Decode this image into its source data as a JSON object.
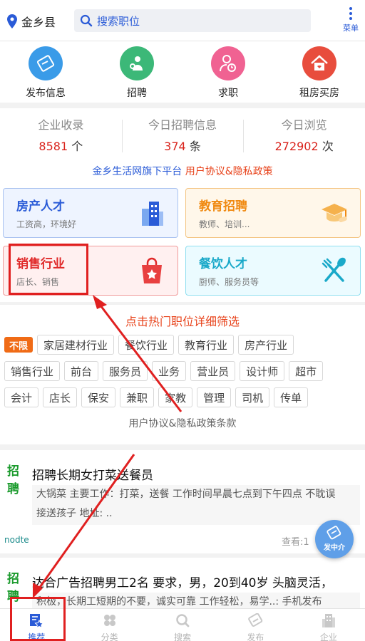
{
  "topbar": {
    "location": "金乡县",
    "search_placeholder": "搜索职位",
    "menu_label": "菜单"
  },
  "quick": [
    {
      "label": "发布信息",
      "icon": "edit-icon",
      "color": "#3a9be8"
    },
    {
      "label": "招聘",
      "icon": "recruit-icon",
      "color": "#3cb878"
    },
    {
      "label": "求职",
      "icon": "job-seek-icon",
      "color": "#f06292"
    },
    {
      "label": "租房买房",
      "icon": "house-icon",
      "color": "#e84d3d"
    }
  ],
  "stats": [
    {
      "title": "企业收录",
      "value": "8581",
      "unit": "个"
    },
    {
      "title": "今日招聘信息",
      "value": "374",
      "unit": "条"
    },
    {
      "title": "今日浏览",
      "value": "272902",
      "unit": "次"
    }
  ],
  "platform": {
    "text": "金乡生活网旗下平台",
    "link": "用户协议&隐私政策"
  },
  "cards": [
    {
      "title": "房产人才",
      "sub": "工资高，环境好",
      "icon": "building-icon"
    },
    {
      "title": "教育招聘",
      "sub": "教师、培训...",
      "icon": "graduation-cap-icon"
    },
    {
      "title": "销售行业",
      "sub": "店长、销售",
      "icon": "shopping-bag-icon"
    },
    {
      "title": "餐饮人才",
      "sub": "厨师、服务员等",
      "icon": "fork-spoon-icon"
    }
  ],
  "tags": {
    "heading": "点击热门职位详细筛选",
    "hot": "不限",
    "row1": [
      "家居建材行业",
      "餐饮行业",
      "教育行业",
      "房产行业"
    ],
    "row2": [
      "销售行业",
      "前台",
      "服务员",
      "业务",
      "营业员",
      "设计师",
      "超市"
    ],
    "row3": [
      "会计",
      "店长",
      "保安",
      "兼职",
      "家教",
      "管理",
      "司机",
      "传单"
    ],
    "footer": "用户协议&隐私政策条款"
  },
  "jobs": [
    {
      "badge": "招聘",
      "title": "招聘长期女打菜送餐员",
      "desc1": "大锅菜 主要工作：打菜，送餐 工作时间早晨七点到下午四点 不耽误",
      "desc2": "接送孩子 地址: ..",
      "source": "nodte",
      "views": "查看:1"
    },
    {
      "badge": "招聘",
      "title": "达合广告招聘男工2名 要求，男，20到40岁 头脑灵活，",
      "desc1": "积极，长期工短期的不要，诚实可靠 工作轻松，易学..: 手机发布"
    }
  ],
  "fab": {
    "label": "发中介"
  },
  "bottomnav": [
    {
      "label": "推荐",
      "icon": "recommend-icon",
      "active": true
    },
    {
      "label": "分类",
      "icon": "category-icon",
      "active": false
    },
    {
      "label": "搜索",
      "icon": "search-icon",
      "active": false
    },
    {
      "label": "发布",
      "icon": "publish-icon",
      "active": false
    },
    {
      "label": "企业",
      "icon": "company-icon",
      "active": false
    }
  ],
  "colors": {
    "accent": "#2a5bd7",
    "highlight": "#d9231c",
    "annotation": "#e02020"
  }
}
